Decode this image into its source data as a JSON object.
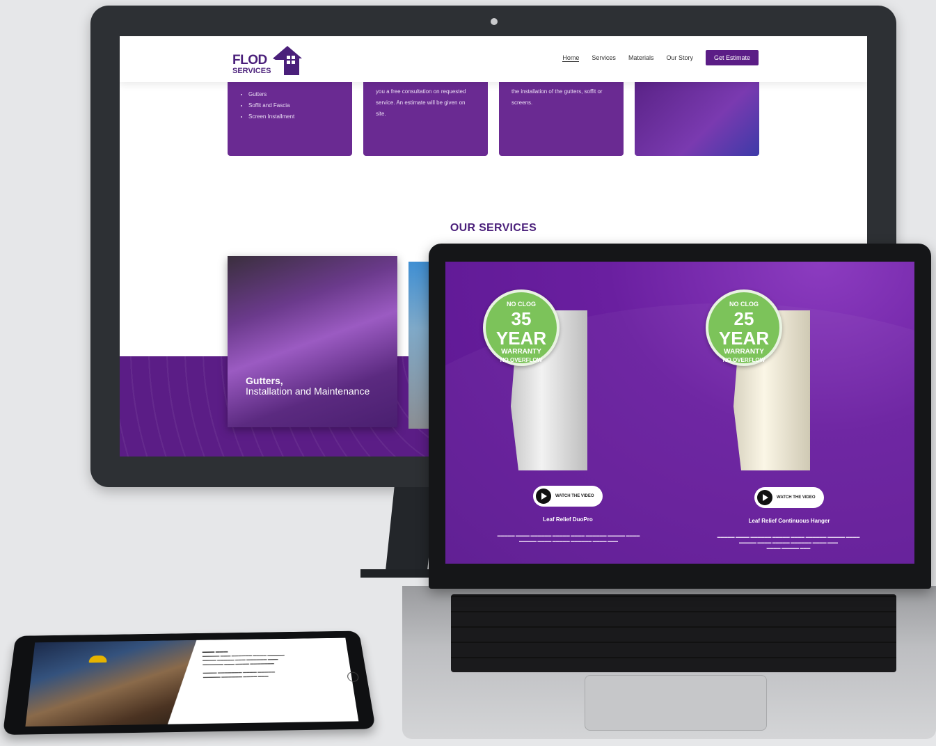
{
  "desktop": {
    "logo": {
      "line1": "FLOD",
      "line2": "SERVICES"
    },
    "nav": {
      "items": [
        "Home",
        "Services",
        "Materials",
        "Our Story"
      ],
      "cta": "Get Estimate"
    },
    "cards": [
      {
        "list": [
          "Gutters",
          "Soffit and Fascia",
          "Screen Installment"
        ]
      },
      {
        "text": "you a free consultation on requested service. An estimate will be given on site."
      },
      {
        "text": "the installation of the gutters, soffit or screens."
      },
      {
        "text": ""
      }
    ],
    "services_title": "OUR SERVICES",
    "service_card": {
      "title": "Gutters,",
      "subtitle": "Installation and Maintenance"
    }
  },
  "laptop": {
    "products": [
      {
        "badge": {
          "top": "NO CLOG",
          "years": "35 YEAR",
          "warranty": "WARRANTY",
          "bottom": "NO OVERFLOW"
        },
        "button": "WATCH THE VIDEO",
        "name": "Leaf Relief DuoPro"
      },
      {
        "badge": {
          "top": "NO CLOG",
          "years": "25 YEAR",
          "warranty": "WARRANTY",
          "bottom": "NO OVERFLOW"
        },
        "button": "WATCH THE VIDEO",
        "name": "Leaf Relief Continuous Hanger"
      }
    ]
  },
  "colors": {
    "brand_purple": "#5b1d86",
    "badge_green": "#7cc35a"
  },
  "icons": [
    "house-logo-icon",
    "play-icon"
  ]
}
